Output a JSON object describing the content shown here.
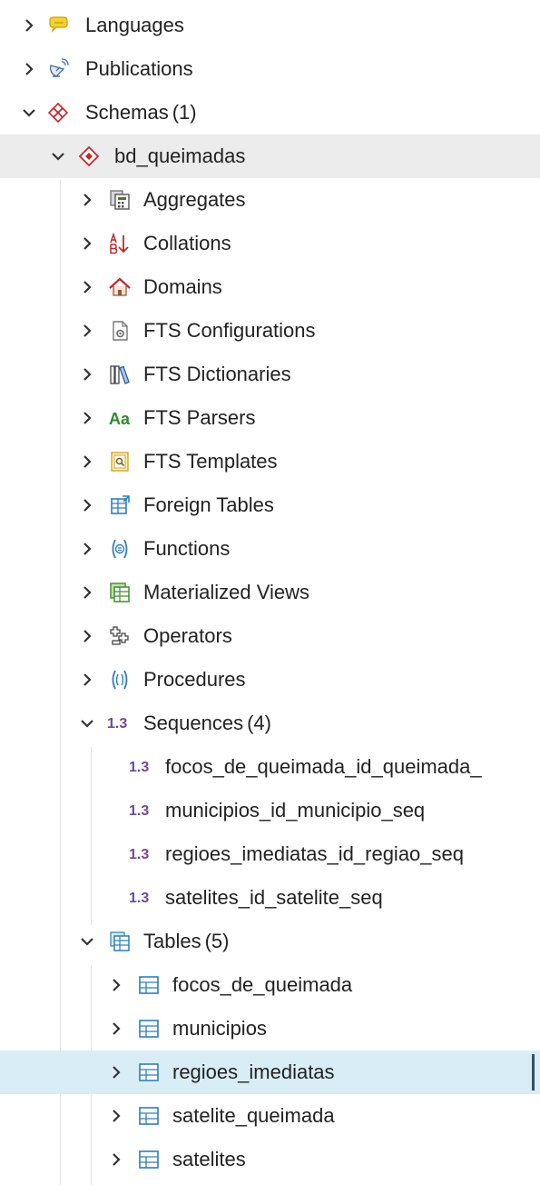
{
  "tree": {
    "languages": {
      "label": "Languages",
      "icon": "languages-icon"
    },
    "publications": {
      "label": "Publications",
      "icon": "publications-icon"
    },
    "schemas": {
      "label": "Schemas",
      "count": "(1)",
      "icon": "schemas-icon"
    },
    "schema": {
      "label": "bd_queimadas",
      "icon": "schema-icon",
      "children": {
        "aggregates": {
          "label": "Aggregates"
        },
        "collations": {
          "label": "Collations"
        },
        "domains": {
          "label": "Domains"
        },
        "fts_configurations": {
          "label": "FTS Configurations"
        },
        "fts_dictionaries": {
          "label": "FTS Dictionaries"
        },
        "fts_parsers": {
          "label": "FTS Parsers",
          "icon_text": "Aa"
        },
        "fts_templates": {
          "label": "FTS Templates"
        },
        "foreign_tables": {
          "label": "Foreign Tables"
        },
        "functions": {
          "label": "Functions"
        },
        "materialized_views": {
          "label": "Materialized Views"
        },
        "operators": {
          "label": "Operators"
        },
        "procedures": {
          "label": "Procedures"
        },
        "sequences": {
          "label": "Sequences",
          "count": "(4)",
          "icon_text": "1.3",
          "items": [
            "focos_de_queimada_id_queimada_",
            "municipios_id_municipio_seq",
            "regioes_imediatas_id_regiao_seq",
            "satelites_id_satelite_seq"
          ]
        },
        "tables": {
          "label": "Tables",
          "count": "(5)",
          "items": [
            "focos_de_queimada",
            "municipios",
            "regioes_imediatas",
            "satelite_queimada",
            "satelites"
          ],
          "selected": "regioes_imediatas"
        }
      }
    }
  },
  "colors": {
    "selected_bg": "#d9edf7",
    "hover_bg": "#ececec",
    "accent_bar": "#30536b",
    "sequence_purple": "#6b4c9a",
    "parser_green": "#2e8b2e"
  }
}
